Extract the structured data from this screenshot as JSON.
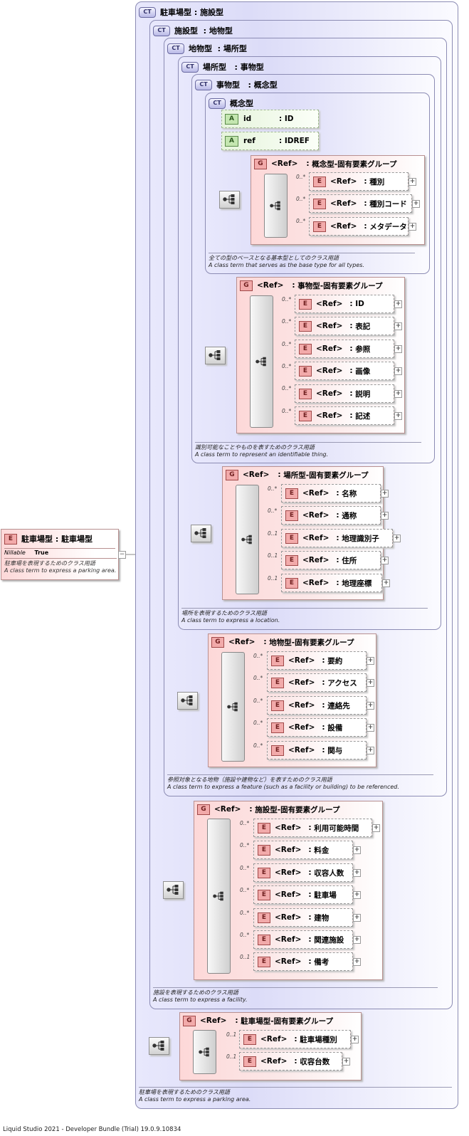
{
  "footer": "Liquid Studio 2021 - Developer Bundle (Trial) 19.0.9.10834",
  "labels": {
    "ct_badge": "CT",
    "g_badge": "G",
    "e_badge": "E",
    "a_badge": "A",
    "ref": "<Ref>",
    "plus": "+"
  },
  "root": {
    "name": "駐車場型",
    "type": "駐車場型",
    "nillable_label": "Nillable",
    "nillable_value": "True",
    "note_ja": "駐車場を表現するためのクラス用語",
    "note_en": "A class term to express a parking area."
  },
  "ct": [
    {
      "name": "駐車場型",
      "base": "施設型",
      "note_ja": "駐車場を表現するためのクラス用語",
      "note_en": "A class term to express a parking area."
    },
    {
      "name": "施設型",
      "base": "地物型",
      "note_ja": "施設を表現するためのクラス用語",
      "note_en": "A class term to express a facility."
    },
    {
      "name": "地物型",
      "base": "場所型",
      "note_ja": "参照対象となる地物（施設や建物など）を表すためのクラス用語",
      "note_en": "A class term to express a feature (such as a facility or building) to be referenced."
    },
    {
      "name": "場所型",
      "base": "事物型",
      "note_ja": "場所を表現するためのクラス用語",
      "note_en": "A class term to express a location."
    },
    {
      "name": "事物型",
      "base": "概念型",
      "note_ja": "識別可能なことやものを表すためのクラス用語",
      "note_en": "A class term to represent an identifiable thing."
    },
    {
      "name": "概念型",
      "base": "",
      "note_ja": "全ての型のベースとなる基本型としてのクラス用語",
      "note_en": "A class term that serves as the base type for all types."
    }
  ],
  "attrs": [
    {
      "name": "id",
      "type": "ID"
    },
    {
      "name": "ref",
      "type": "IDREF"
    }
  ],
  "groups": [
    {
      "name": "概念型-固有要素グループ",
      "items": [
        {
          "card": "0..*",
          "name": "種別"
        },
        {
          "card": "0..*",
          "name": "種別コード"
        },
        {
          "card": "0..*",
          "name": "メタデータ"
        }
      ]
    },
    {
      "name": "事物型-固有要素グループ",
      "items": [
        {
          "card": "0..*",
          "name": "ID"
        },
        {
          "card": "0..*",
          "name": "表記"
        },
        {
          "card": "0..*",
          "name": "参照"
        },
        {
          "card": "0..*",
          "name": "画像"
        },
        {
          "card": "0..*",
          "name": "説明"
        },
        {
          "card": "0..*",
          "name": "記述"
        }
      ]
    },
    {
      "name": "場所型-固有要素グループ",
      "items": [
        {
          "card": "0..*",
          "name": "名称"
        },
        {
          "card": "0..*",
          "name": "通称"
        },
        {
          "card": "0..1",
          "name": "地理識別子"
        },
        {
          "card": "0..1",
          "name": "住所"
        },
        {
          "card": "0..1",
          "name": "地理座標"
        }
      ]
    },
    {
      "name": "地物型-固有要素グループ",
      "items": [
        {
          "card": "0..*",
          "name": "要約"
        },
        {
          "card": "0..*",
          "name": "アクセス"
        },
        {
          "card": "0..*",
          "name": "連絡先"
        },
        {
          "card": "0..*",
          "name": "設備"
        },
        {
          "card": "0..*",
          "name": "関与"
        }
      ]
    },
    {
      "name": "施設型-固有要素グループ",
      "items": [
        {
          "card": "0..*",
          "name": "利用可能時間"
        },
        {
          "card": "0..*",
          "name": "料金"
        },
        {
          "card": "0..*",
          "name": "収容人数"
        },
        {
          "card": "0..*",
          "name": "駐車場"
        },
        {
          "card": "0..*",
          "name": "建物"
        },
        {
          "card": "0..*",
          "name": "関連施設"
        },
        {
          "card": "0..1",
          "name": "備考"
        }
      ]
    },
    {
      "name": "駐車場型-固有要素グループ",
      "items": [
        {
          "card": "0..1",
          "name": "駐車場種別"
        },
        {
          "card": "0..1",
          "name": "収容台数"
        }
      ]
    }
  ]
}
